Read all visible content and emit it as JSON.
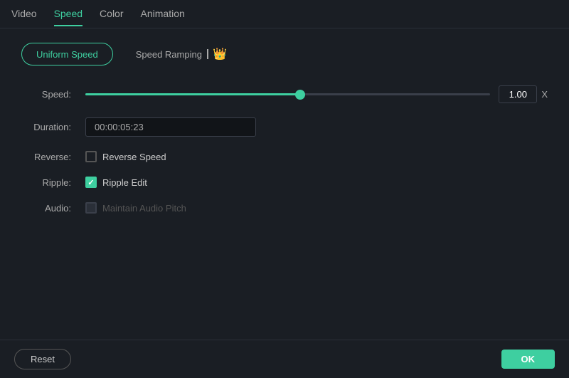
{
  "topNav": {
    "tabs": [
      {
        "id": "video",
        "label": "Video",
        "active": false
      },
      {
        "id": "speed",
        "label": "Speed",
        "active": true
      },
      {
        "id": "color",
        "label": "Color",
        "active": false
      },
      {
        "id": "animation",
        "label": "Animation",
        "active": false
      }
    ]
  },
  "speedTabs": {
    "uniformSpeed": "Uniform Speed",
    "speedRamping": "Speed Ramping"
  },
  "form": {
    "speedLabel": "Speed:",
    "speedValue": "1.00",
    "speedUnit": "X",
    "durationLabel": "Duration:",
    "durationValue": "00:00:05:23",
    "reverseLabel": "Reverse:",
    "reverseCheckboxLabel": "Reverse Speed",
    "reverseChecked": false,
    "rippleLabel": "Ripple:",
    "rippleCheckboxLabel": "Ripple Edit",
    "rippleChecked": true,
    "audioLabel": "Audio:",
    "audioCheckboxLabel": "Maintain Audio Pitch",
    "audioDisabled": true
  },
  "footer": {
    "resetLabel": "Reset",
    "okLabel": "OK"
  },
  "colors": {
    "accent": "#3ecfa0",
    "crown": "#e8a020"
  }
}
